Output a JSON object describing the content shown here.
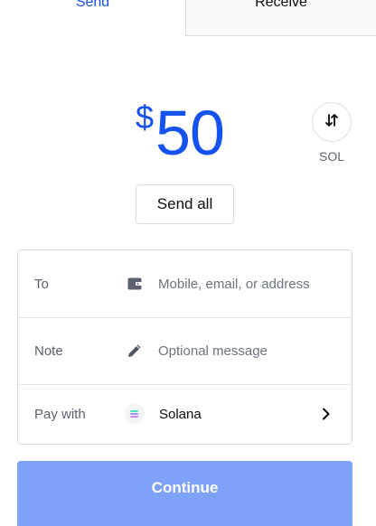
{
  "tabs": [
    {
      "label": "Send",
      "active": true
    },
    {
      "label": "Receive",
      "active": false
    }
  ],
  "amount": {
    "currency_symbol": "$",
    "value": "50"
  },
  "swap": {
    "icon": "swap-arrows-icon",
    "label": "SOL"
  },
  "send_all_label": "Send all",
  "form": {
    "to": {
      "label": "To",
      "icon": "wallet-icon",
      "placeholder": "Mobile, email, or address",
      "value": ""
    },
    "note": {
      "label": "Note",
      "icon": "pencil-icon",
      "placeholder": "Optional message",
      "value": ""
    },
    "pay_with": {
      "label": "Pay with",
      "icon": "solana-icon",
      "value": "Solana"
    }
  },
  "continue_label": "Continue",
  "colors": {
    "accent": "#1652f0",
    "button_disabled": "#7fa2f8",
    "border": "#dcdde0"
  }
}
